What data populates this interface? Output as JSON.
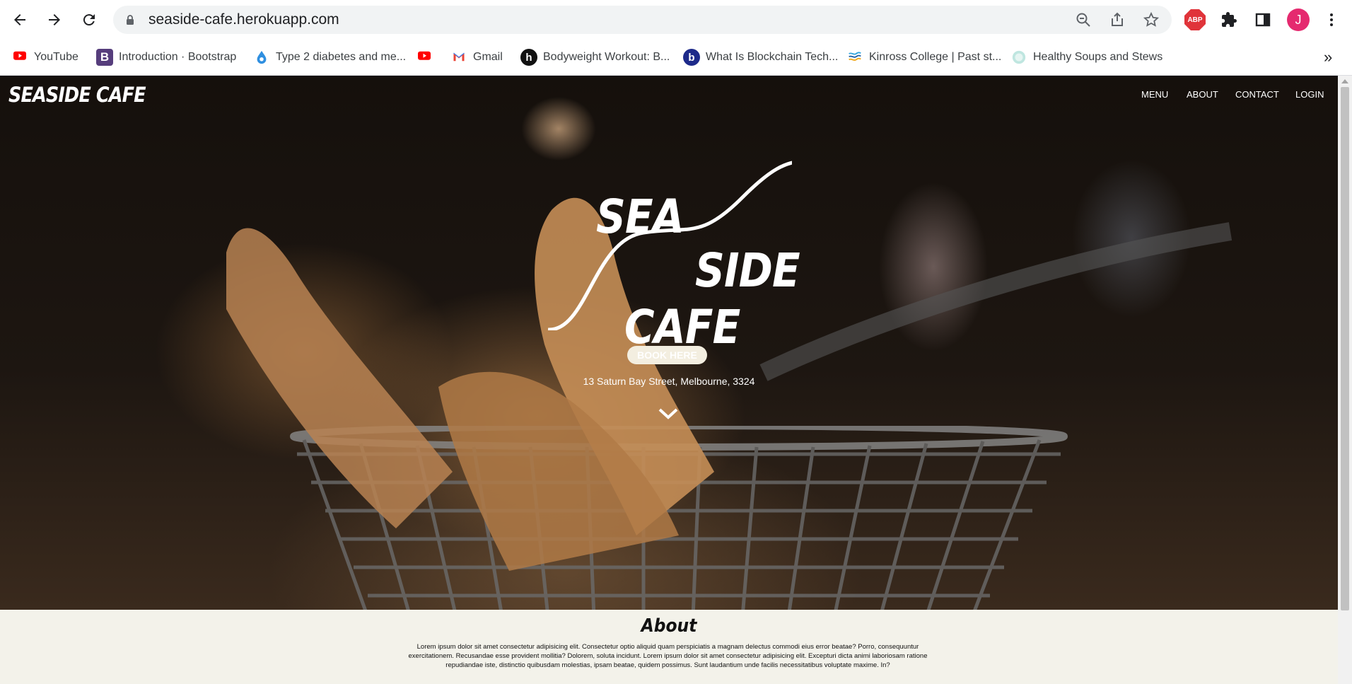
{
  "browser": {
    "url": "seaside-cafe.herokuapp.com",
    "profile_initial": "J",
    "abp_label": "ABP",
    "bookmarks": [
      {
        "label": "YouTube",
        "icon": "youtube-icon"
      },
      {
        "label": "Introduction · Bootstrap",
        "icon": "bootstrap-icon",
        "icon_text": "B"
      },
      {
        "label": "Type 2 diabetes and me...",
        "icon": "diabetes-site-icon"
      },
      {
        "label": "",
        "icon": "youtube-icon"
      },
      {
        "label": "Gmail",
        "icon": "gmail-icon",
        "icon_text": "M"
      },
      {
        "label": "Bodyweight Workout: B...",
        "icon": "workout-site-icon",
        "icon_text": "h"
      },
      {
        "label": "What Is Blockchain Tech...",
        "icon": "blockchain-site-icon",
        "icon_text": "b"
      },
      {
        "label": "Kinross College | Past st...",
        "icon": "kinross-icon"
      },
      {
        "label": "Healthy Soups and Stews",
        "icon": "soups-site-icon"
      }
    ],
    "overflow_label": "»"
  },
  "site": {
    "logo": "SEASIDE CAFE",
    "nav": [
      "MENU",
      "ABOUT",
      "CONTACT",
      "LOGIN"
    ],
    "hero_logo": {
      "line1": "SEA",
      "line2": "SIDE",
      "line3": "CAFE"
    },
    "book_button": "BOOK HERE",
    "address": "13 Saturn Bay Street, Melbourne, 3324"
  },
  "about": {
    "title": "About",
    "text": "Lorem ipsum dolor sit amet consectetur adipisicing elit. Consectetur optio aliquid quam perspiciatis a magnam delectus commodi eius error beatae? Porro, consequuntur exercitationem. Recusandae esse provident mollitia? Dolorem, soluta incidunt. Lorem ipsum dolor sit amet consectetur adipisicing elit. Excepturi dicta animi laboriosam ratione repudiandae iste, distinctio quibusdam molestias, ipsam beatae, quidem possimus. Sunt laudantium unde facilis necessitatibus voluptate maxime. In?"
  },
  "colors": {
    "youtube": "#ff0000",
    "bootstrap": "#563d7c",
    "avatar": "#e52a6f",
    "abp": "#e0343a",
    "about_bg": "#f3f2ea"
  }
}
